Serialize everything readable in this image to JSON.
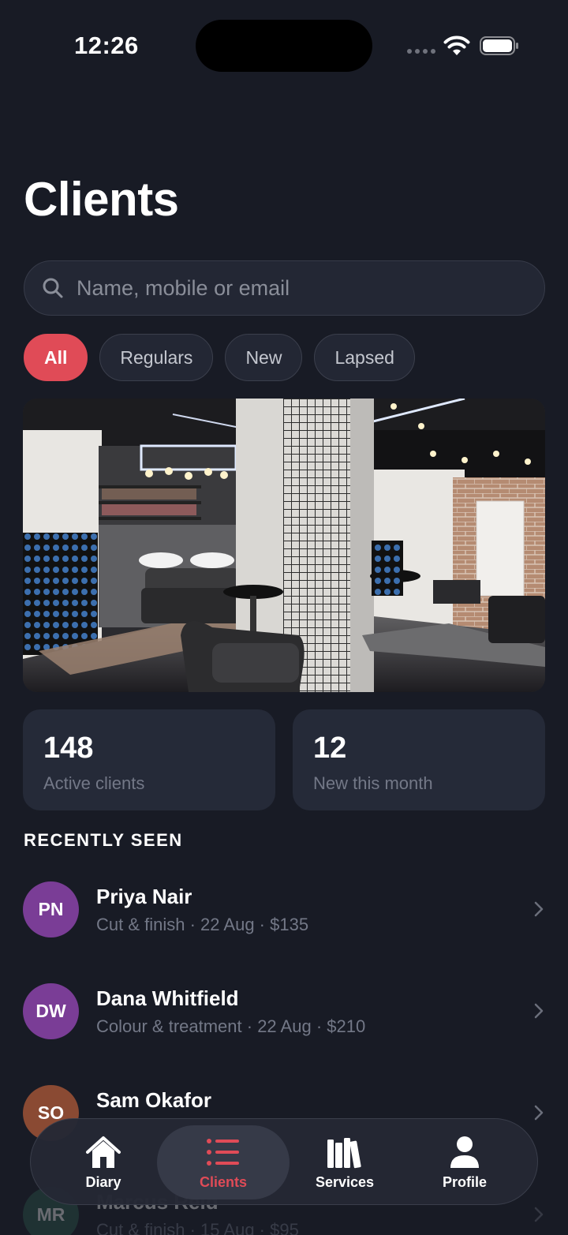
{
  "status_bar": {
    "time": "12:26"
  },
  "header": {
    "title": "Clients"
  },
  "search": {
    "placeholder": "Name, mobile or email",
    "value": ""
  },
  "filters": [
    {
      "label": "All",
      "active": true
    },
    {
      "label": "Regulars",
      "active": false
    },
    {
      "label": "New",
      "active": false
    },
    {
      "label": "Lapsed",
      "active": false
    }
  ],
  "stats": [
    {
      "value": "148",
      "label": "Active clients"
    },
    {
      "value": "12",
      "label": "New this month"
    }
  ],
  "recently_seen": {
    "title": "RECENTLY SEEN",
    "clients": [
      {
        "initials": "PN",
        "name": "Priya Nair",
        "meta": "Cut & finish · 22 Aug · $135",
        "avatar_color": "#7a3d96"
      },
      {
        "initials": "DW",
        "name": "Dana Whitfield",
        "meta": "Colour & treatment · 22 Aug · $210",
        "avatar_color": "#7a3d96"
      },
      {
        "initials": "SO",
        "name": "Sam Okafor",
        "meta": "",
        "avatar_color": "#8a4a33"
      },
      {
        "initials": "MR",
        "name": "Marcus Reid",
        "meta": "Cut & finish · 15 Aug · $95",
        "avatar_color": "#2e5d4d"
      }
    ]
  },
  "tab_bar": {
    "tabs": [
      {
        "label": "Diary",
        "icon": "home-icon",
        "active": false
      },
      {
        "label": "Clients",
        "icon": "list-icon",
        "active": true
      },
      {
        "label": "Services",
        "icon": "books-icon",
        "active": false
      },
      {
        "label": "Profile",
        "icon": "person-icon",
        "active": false
      }
    ]
  },
  "colors": {
    "accent": "#e04b57",
    "background": "#181b25",
    "card": "#252a38",
    "muted_text": "#737887"
  }
}
